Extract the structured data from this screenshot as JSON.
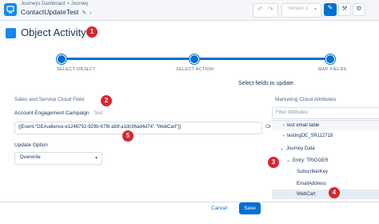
{
  "header": {
    "breadcrumb_parent": "Journeys Dashboard",
    "breadcrumb_current": "Journey",
    "journey_name": "ContactUpdateTest",
    "version_label": "Version 1"
  },
  "page": {
    "title": "Object Activity"
  },
  "badges": [
    "1",
    "2",
    "3",
    "4",
    "5"
  ],
  "steps": [
    {
      "label": "SELECT OBJECT"
    },
    {
      "label": "SELECT ACTION"
    },
    {
      "label": "MAP FIELDS"
    }
  ],
  "instruction": "Select fields to update.",
  "left_section": {
    "heading": "Sales and Service Cloud Field",
    "field_label": "Account Engagement Campaign",
    "field_type": "Text",
    "field_value": "{{Event.\"DEAudience-e1246792-929b-67f6-afdf-a1dc96ad4d74\".\"WebCart\"}}",
    "or_label": "Or",
    "update_option_label": "Update Option",
    "update_option_value": "Overwrite"
  },
  "right_section": {
    "heading": "Marketing Cloud Attributes",
    "filter_placeholder": "Filter Attributes",
    "tree": [
      {
        "label": "test email table"
      },
      {
        "label": "testingDE_SR112718"
      },
      {
        "label": "Journey Data"
      },
      {
        "label": "Entry: TRIGGER"
      },
      {
        "label": "SubscriberKey"
      },
      {
        "label": "EmailAddress"
      },
      {
        "label": "WebCart"
      }
    ]
  },
  "footer": {
    "cancel_label": "Cancel",
    "save_label": "Save"
  },
  "colors": {
    "accent": "#0070d2",
    "badge": "#d9262c",
    "text": "#16325c"
  }
}
